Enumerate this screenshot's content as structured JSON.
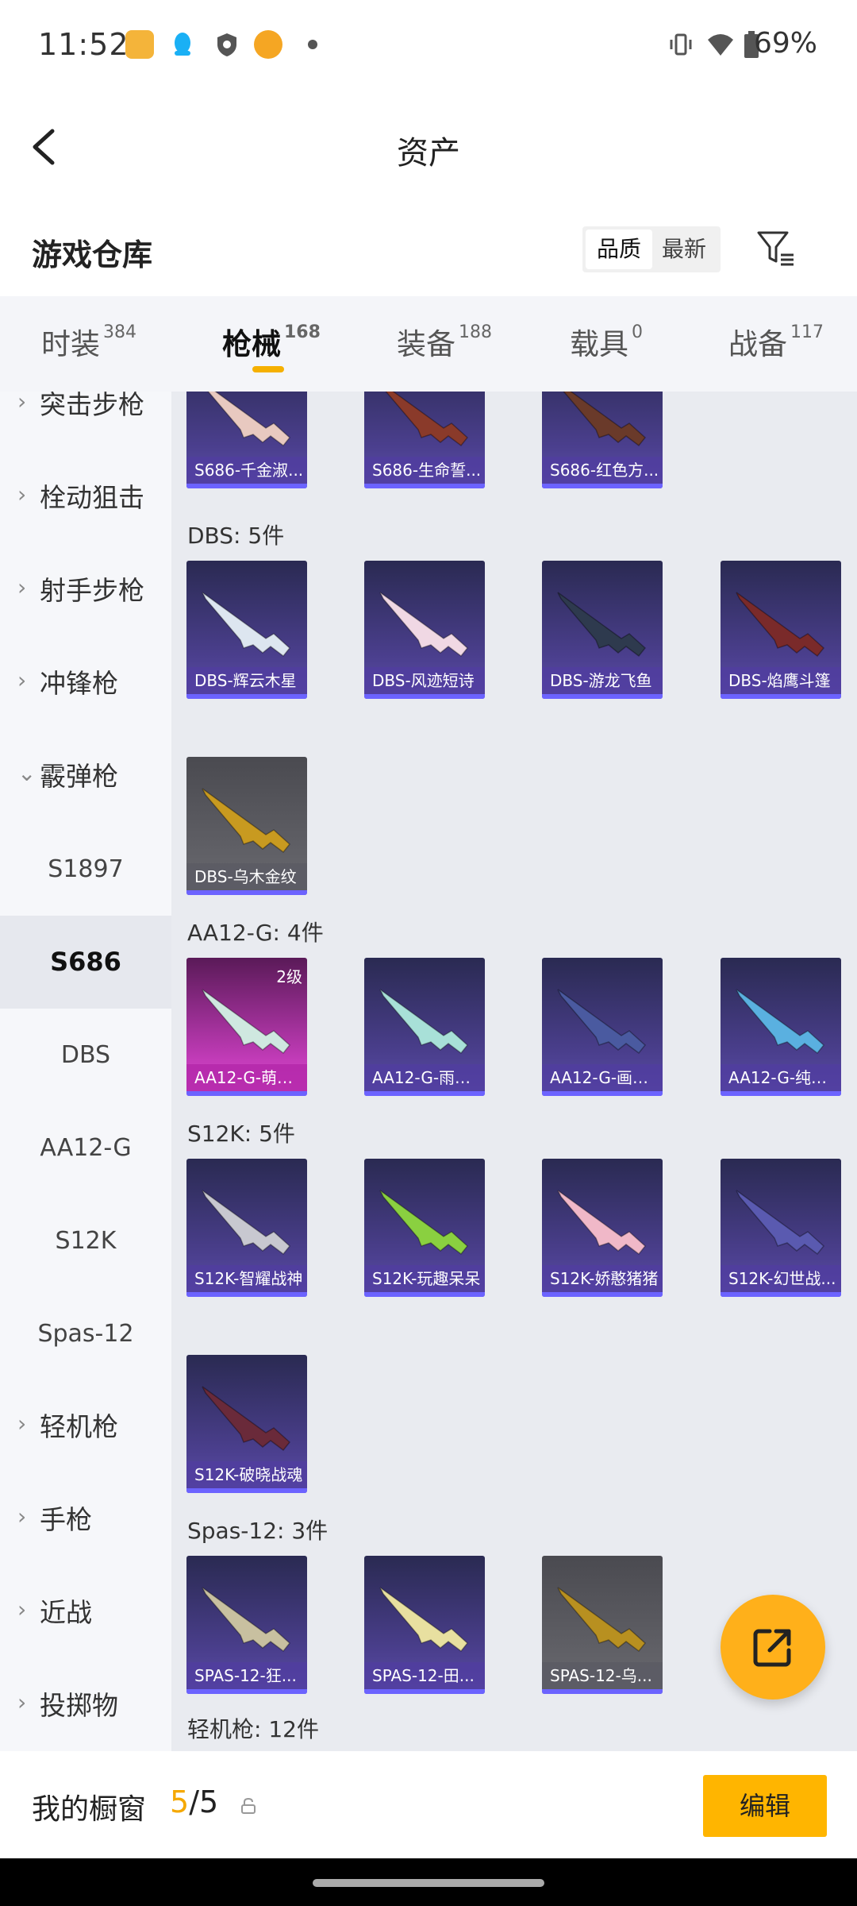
{
  "status_bar": {
    "time": "11:52",
    "battery": "69%",
    "icons": [
      "app-notification-icon",
      "qq-icon",
      "shield-icon",
      "orange-app-icon",
      "dot-icon",
      "vibrate-icon",
      "wifi-icon",
      "battery-icon"
    ]
  },
  "header": {
    "title": "资产"
  },
  "warehouse": {
    "title": "游戏仓库",
    "sort_options": [
      {
        "label": "品质",
        "active": true
      },
      {
        "label": "最新",
        "active": false
      }
    ]
  },
  "tabs": [
    {
      "label": "时装",
      "count": "384",
      "active": false
    },
    {
      "label": "枪械",
      "count": "168",
      "active": true
    },
    {
      "label": "装备",
      "count": "188",
      "active": false
    },
    {
      "label": "载具",
      "count": "0",
      "active": false
    },
    {
      "label": "战备",
      "count": "117",
      "active": false
    }
  ],
  "sidebar": {
    "items": [
      {
        "label": "突击步枪",
        "type": "category",
        "expanded": false
      },
      {
        "label": "栓动狙击",
        "type": "category",
        "expanded": false
      },
      {
        "label": "射手步枪",
        "type": "category",
        "expanded": false
      },
      {
        "label": "冲锋枪",
        "type": "category",
        "expanded": false
      },
      {
        "label": "霰弹枪",
        "type": "category",
        "expanded": true
      },
      {
        "label": "S1897",
        "type": "sub"
      },
      {
        "label": "S686",
        "type": "sub",
        "selected": true
      },
      {
        "label": "DBS",
        "type": "sub"
      },
      {
        "label": "AA12-G",
        "type": "sub"
      },
      {
        "label": "S12K",
        "type": "sub"
      },
      {
        "label": "Spas-12",
        "type": "sub"
      },
      {
        "label": "轻机枪",
        "type": "category",
        "expanded": false
      },
      {
        "label": "手枪",
        "type": "category",
        "expanded": false
      },
      {
        "label": "近战",
        "type": "category",
        "expanded": false
      },
      {
        "label": "投掷物",
        "type": "category",
        "expanded": false
      }
    ]
  },
  "content": {
    "s686_cards": [
      {
        "name": "S686-千金淑...",
        "style": "purple",
        "gun_color": "#e8c9c0"
      },
      {
        "name": "S686-生命誓...",
        "style": "purple",
        "gun_color": "#8a3a2a"
      },
      {
        "name": "S686-红色方...",
        "style": "purple",
        "gun_color": "#6a3a2a"
      }
    ],
    "sections": [
      {
        "title": "DBS: 5件",
        "cards": [
          {
            "name": "DBS-辉云木星",
            "style": "purple",
            "gun_color": "#dde6f0"
          },
          {
            "name": "DBS-风迹短诗",
            "style": "purple",
            "gun_color": "#f0d8e4"
          },
          {
            "name": "DBS-游龙飞鱼",
            "style": "purple",
            "gun_color": "#2e3a4e"
          },
          {
            "name": "DBS-焰鹰斗篷",
            "style": "purple",
            "gun_color": "#7a2a2a"
          },
          {
            "name": "DBS-乌木金纹",
            "style": "grey",
            "gun_color": "#c89a20"
          }
        ]
      },
      {
        "title": "AA12-G: 4件",
        "cards": [
          {
            "name": "AA12-G-萌骑...",
            "style": "pink",
            "gun_color": "#cfe8e0",
            "level": "2级"
          },
          {
            "name": "AA12-G-雨过...",
            "style": "purple",
            "gun_color": "#a8e0d8"
          },
          {
            "name": "AA12-G-画境...",
            "style": "purple",
            "gun_color": "#4a5aa0"
          },
          {
            "name": "AA12-G-纯真...",
            "style": "purple",
            "gun_color": "#5ab0e0"
          }
        ]
      },
      {
        "title": "S12K: 5件",
        "cards": [
          {
            "name": "S12K-智耀战神",
            "style": "purple",
            "gun_color": "#c8c8d0"
          },
          {
            "name": "S12K-玩趣呆呆",
            "style": "purple",
            "gun_color": "#8ad040"
          },
          {
            "name": "S12K-娇憨猪猪",
            "style": "purple",
            "gun_color": "#f0b8c8"
          },
          {
            "name": "S12K-幻世战...",
            "style": "purple",
            "gun_color": "#5a5ab0"
          },
          {
            "name": "S12K-破晓战魂",
            "style": "purple",
            "gun_color": "#6a2a3a"
          }
        ]
      },
      {
        "title": "Spas-12: 3件",
        "cards": [
          {
            "name": "SPAS-12-狂...",
            "style": "purple",
            "gun_color": "#c8c0a0"
          },
          {
            "name": "SPAS-12-田...",
            "style": "purple",
            "gun_color": "#e8e0a0"
          },
          {
            "name": "SPAS-12-乌...",
            "style": "grey",
            "gun_color": "#b89020"
          }
        ]
      },
      {
        "title": "轻机枪: 12件",
        "cards": []
      }
    ]
  },
  "bottom_bar": {
    "title": "我的橱窗",
    "current": "5",
    "separator": "/",
    "total": "5",
    "edit_label": "编辑"
  },
  "colors": {
    "accent": "#ffb500",
    "card_purple": "#4b3f8e",
    "card_pink": "#c43cba",
    "card_grey": "#6a6a70"
  }
}
